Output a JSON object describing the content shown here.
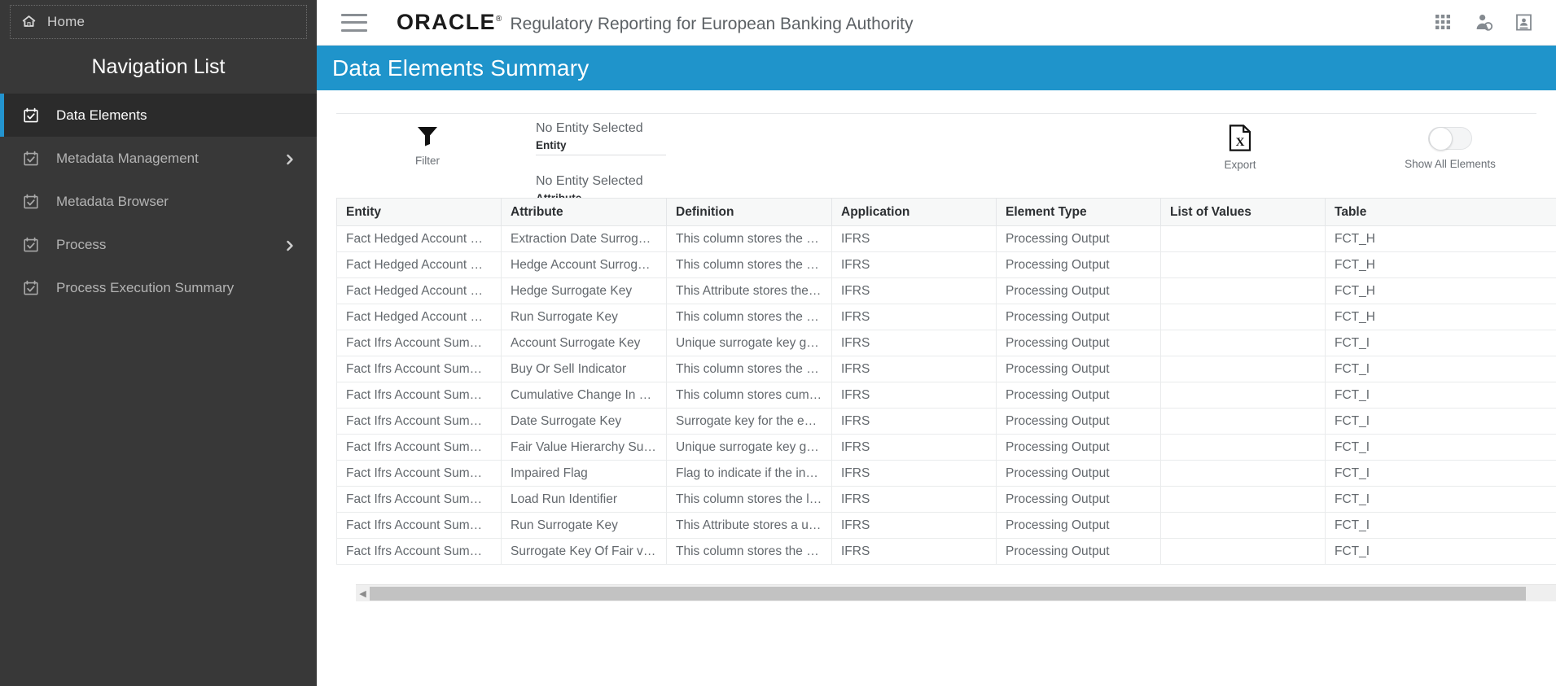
{
  "sidebar": {
    "home_label": "Home",
    "nav_title": "Navigation List",
    "items": [
      {
        "label": "Data Elements",
        "icon": "calendar-check-icon",
        "active": true,
        "expandable": false
      },
      {
        "label": "Metadata Management",
        "icon": "calendar-check-icon",
        "active": false,
        "expandable": true
      },
      {
        "label": "Metadata Browser",
        "icon": "calendar-check-icon",
        "active": false,
        "expandable": false
      },
      {
        "label": "Process",
        "icon": "calendar-check-icon",
        "active": false,
        "expandable": true
      },
      {
        "label": "Process Execution Summary",
        "icon": "calendar-check-icon",
        "active": false,
        "expandable": false
      }
    ]
  },
  "header": {
    "menu_icon": "hamburger-menu-icon",
    "brand": "ORACLE",
    "brand_mark": "®",
    "app_title": "Regulatory Reporting for European Banking Authority",
    "icons": [
      {
        "name": "apps-grid-icon"
      },
      {
        "name": "user-settings-icon"
      },
      {
        "name": "id-badge-icon"
      }
    ]
  },
  "page": {
    "title": "Data Elements Summary",
    "banner_color": "#1f94cb"
  },
  "toolbar": {
    "filter": {
      "label": "Filter",
      "icon": "filter-funnel-icon"
    },
    "entity_field": {
      "value": "No Entity Selected",
      "label": "Entity"
    },
    "attribute_field": {
      "value": "No Entity Selected",
      "label": "Attribute"
    },
    "export": {
      "label": "Export",
      "icon": "excel-export-icon"
    },
    "show_all": {
      "label": "Show All Elements",
      "state": "off"
    }
  },
  "table": {
    "columns": [
      "Entity",
      "Attribute",
      "Definition",
      "Application",
      "Element Type",
      "List of Values",
      "Table"
    ],
    "rows": [
      [
        "Fact Hedged Account Map",
        "Extraction Date Surrogate Key",
        "This column stores the surro...",
        "IFRS",
        "Processing Output",
        "",
        "FCT_H"
      ],
      [
        "Fact Hedged Account Map",
        "Hedge Account Surrogate Key",
        "This column stores the uniq...",
        "IFRS",
        "Processing Output",
        "",
        "FCT_H"
      ],
      [
        "Fact Hedged Account Map",
        "Hedge Surrogate Key",
        "This Attribute stores the surr...",
        "IFRS",
        "Processing Output",
        "",
        "FCT_H"
      ],
      [
        "Fact Hedged Account Map",
        "Run Surrogate Key",
        "This column stores the Surro...",
        "IFRS",
        "Processing Output",
        "",
        "FCT_H"
      ],
      [
        "Fact Ifrs Account Summary",
        "Account Surrogate Key",
        "Unique surrogate key gener...",
        "IFRS",
        "Processing Output",
        "",
        "FCT_I"
      ],
      [
        "Fact Ifrs Account Summary",
        "Buy Or Sell Indicator",
        "This column stores the flag f...",
        "IFRS",
        "Processing Output",
        "",
        "FCT_I"
      ],
      [
        "Fact Ifrs Account Summary",
        "Cumulative Change In Fair V...",
        "This column stores cumulati...",
        "IFRS",
        "Processing Output",
        "",
        "FCT_I"
      ],
      [
        "Fact Ifrs Account Summary",
        "Date Surrogate Key",
        "Surrogate key for the extract...",
        "IFRS",
        "Processing Output",
        "",
        "FCT_I"
      ],
      [
        "Fact Ifrs Account Summary",
        "Fair Value Hierarchy Surroga...",
        "Unique surrogate key gener...",
        "IFRS",
        "Processing Output",
        "",
        "FCT_I"
      ],
      [
        "Fact Ifrs Account Summary",
        "Impaired Flag",
        "Flag to indicate if the invest...",
        "IFRS",
        "Processing Output",
        "",
        "FCT_I"
      ],
      [
        "Fact Ifrs Account Summary",
        "Load Run Identifier",
        "This column stores the load ...",
        "IFRS",
        "Processing Output",
        "",
        "FCT_I"
      ],
      [
        "Fact Ifrs Account Summary",
        "Run Surrogate Key",
        "This Attribute stores  a uniq...",
        "IFRS",
        "Processing Output",
        "",
        "FCT_I"
      ],
      [
        "Fact Ifrs Account Summary",
        "Surrogate Key Of Fair value Ch...",
        "This column stores the uniq...",
        "IFRS",
        "Processing Output",
        "",
        "FCT_I"
      ]
    ]
  },
  "scrollbar": {
    "left_arrow": "◀"
  }
}
